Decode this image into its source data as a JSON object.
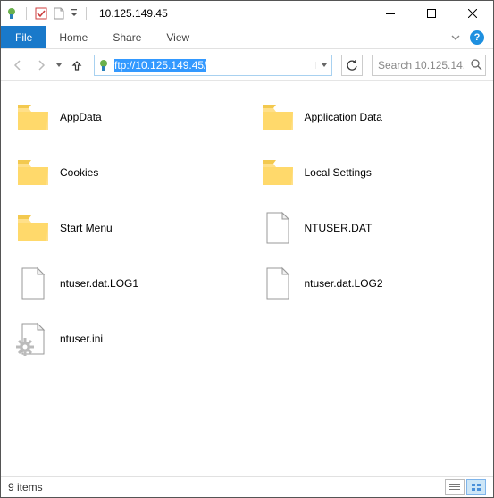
{
  "title": "10.125.149.45",
  "ribbon": {
    "file": "File",
    "home": "Home",
    "share": "Share",
    "view": "View"
  },
  "address": {
    "value": "ftp://10.125.149.45/"
  },
  "search": {
    "placeholder": "Search 10.125.14..."
  },
  "items": [
    {
      "name": "AppData",
      "type": "folder"
    },
    {
      "name": "Application Data",
      "type": "folder"
    },
    {
      "name": "Cookies",
      "type": "folder"
    },
    {
      "name": "Local Settings",
      "type": "folder"
    },
    {
      "name": "Start Menu",
      "type": "folder"
    },
    {
      "name": "NTUSER.DAT",
      "type": "file"
    },
    {
      "name": "ntuser.dat.LOG1",
      "type": "file"
    },
    {
      "name": "ntuser.dat.LOG2",
      "type": "file"
    },
    {
      "name": "ntuser.ini",
      "type": "ini"
    }
  ],
  "status": {
    "count": "9 items"
  }
}
